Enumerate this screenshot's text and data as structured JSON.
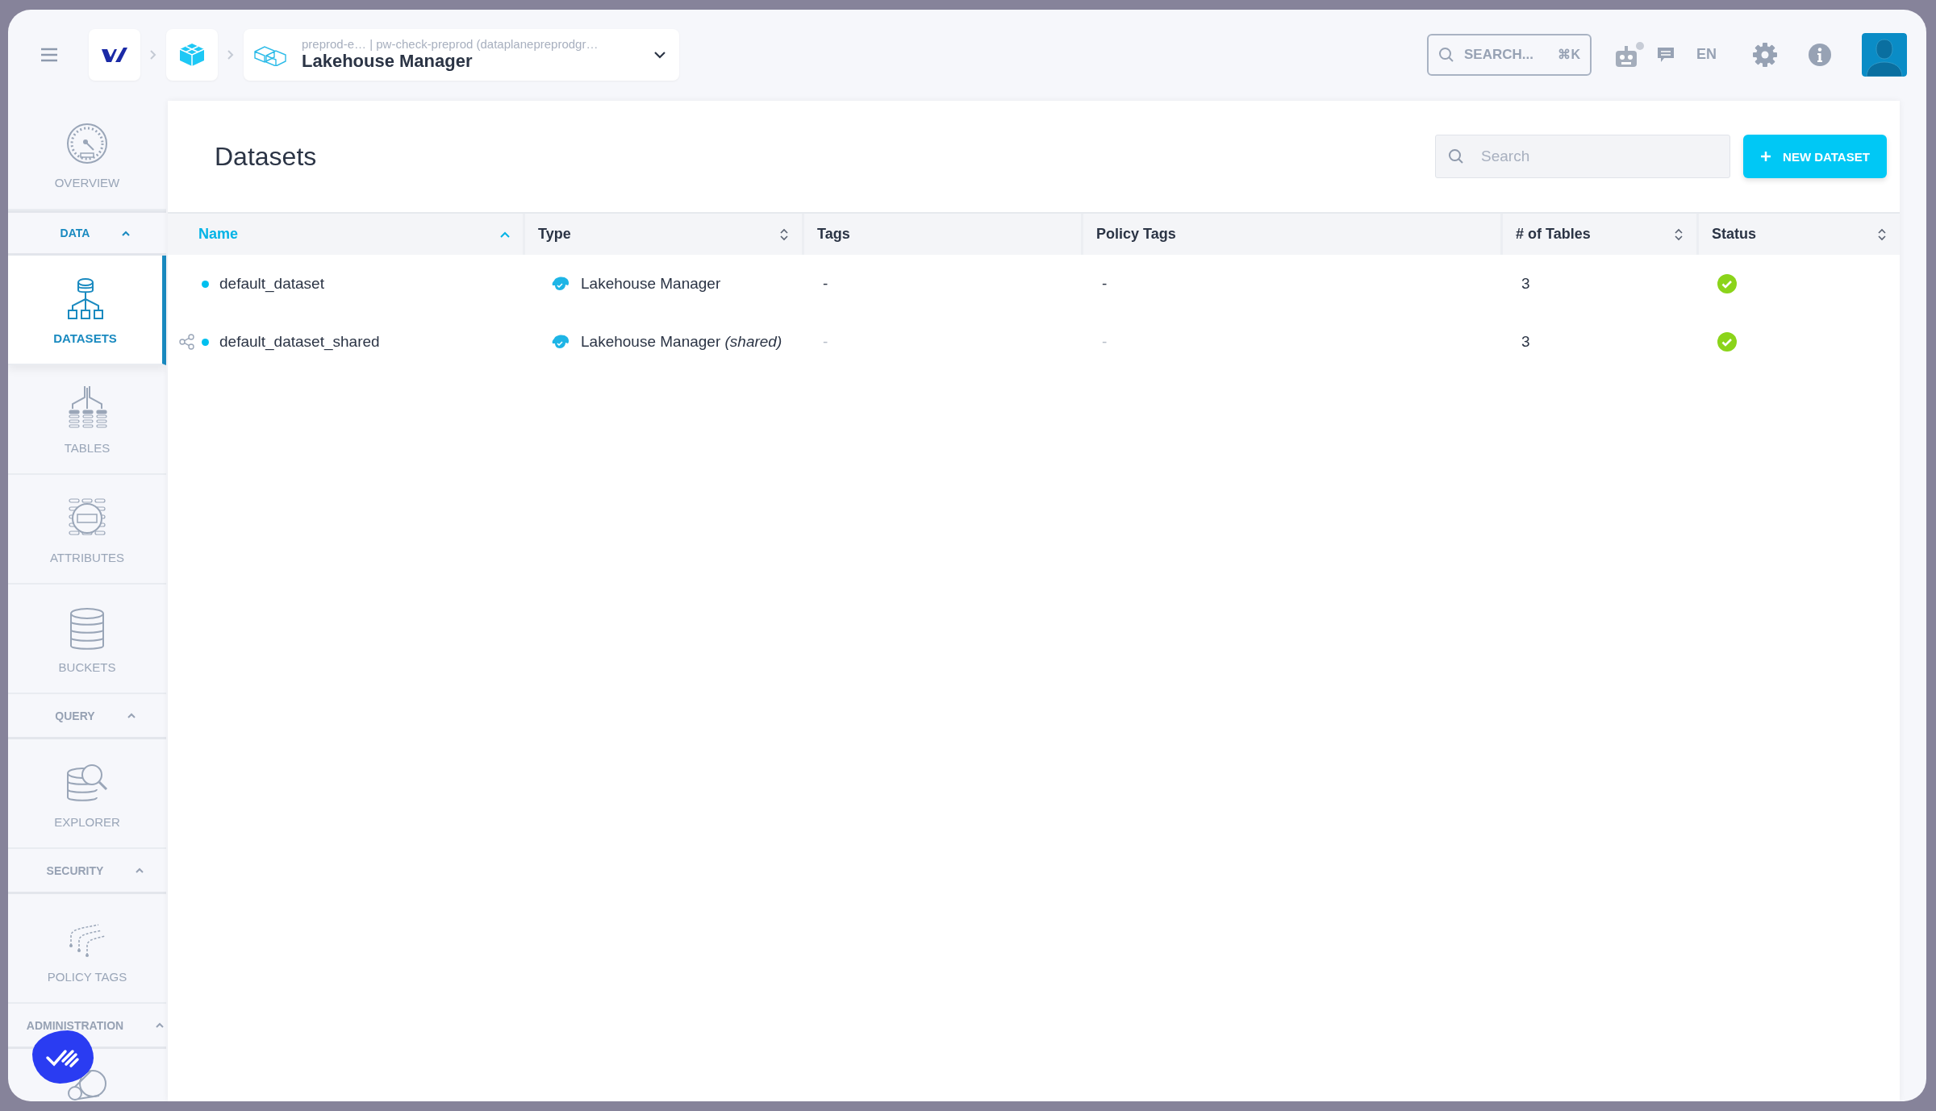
{
  "topbar": {
    "breadcrumb": {
      "context": "preprod-e… | pw-check-preprod (dataplanepreprodgr…",
      "title": "Lakehouse Manager"
    },
    "search": {
      "label": "SEARCH...",
      "shortcut": "⌘K"
    },
    "language": "EN"
  },
  "sidebar": {
    "items": [
      {
        "kind": "item",
        "label": "OVERVIEW",
        "selected": false
      },
      {
        "kind": "section",
        "label": "DATA",
        "expanded": true,
        "selected": true
      },
      {
        "kind": "item",
        "label": "DATASETS",
        "selected": true
      },
      {
        "kind": "item",
        "label": "TABLES",
        "selected": false
      },
      {
        "kind": "item",
        "label": "ATTRIBUTES",
        "selected": false
      },
      {
        "kind": "item",
        "label": "BUCKETS",
        "selected": false
      },
      {
        "kind": "section",
        "label": "QUERY",
        "expanded": true,
        "selected": false
      },
      {
        "kind": "item",
        "label": "EXPLORER",
        "selected": false
      },
      {
        "kind": "section",
        "label": "SECURITY",
        "expanded": true,
        "selected": false
      },
      {
        "kind": "item",
        "label": "POLICY TAGS",
        "selected": false
      },
      {
        "kind": "section",
        "label": "ADMINISTRATION",
        "expanded": true,
        "selected": false
      },
      {
        "kind": "item",
        "selected": false
      }
    ]
  },
  "page": {
    "title": "Datasets",
    "search": {
      "placeholder": "Search"
    },
    "new_button": "NEW DATASET"
  },
  "table": {
    "columns": [
      {
        "label": "Name",
        "sortable": true,
        "sorted": true
      },
      {
        "label": "Type",
        "sortable": true,
        "sorted": false
      },
      {
        "label": "Tags",
        "sortable": false,
        "sorted": false
      },
      {
        "label": "Policy Tags",
        "sortable": false,
        "sorted": false
      },
      {
        "label": "# of Tables",
        "sortable": true,
        "sorted": false
      },
      {
        "label": "Status",
        "sortable": true,
        "sorted": false
      }
    ],
    "rows": [
      {
        "name": "default_dataset",
        "shared": false,
        "type": "Lakehouse Manager",
        "tags": "-",
        "policy_tags": "-",
        "tables": "3",
        "healthy": true
      },
      {
        "name": "default_dataset_shared",
        "shared": true,
        "type": "Lakehouse Manager *(shared)*",
        "tags": "-",
        "policy_tags": "-",
        "tables": "3",
        "healthy": true
      }
    ]
  }
}
